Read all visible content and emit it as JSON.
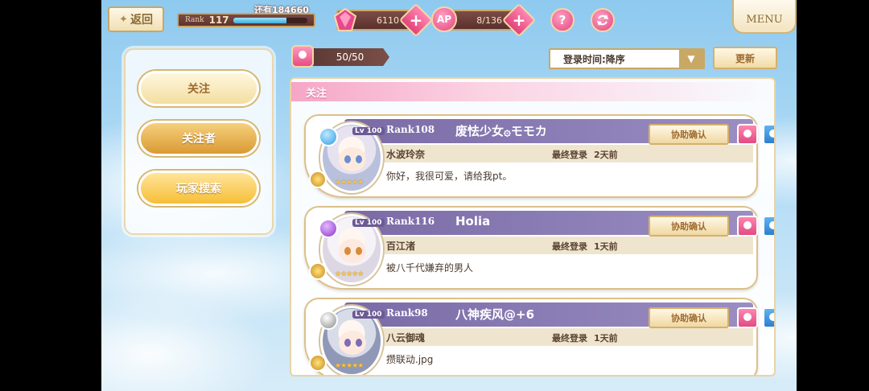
{
  "header": {
    "back_label": "返回",
    "rank_label": "Rank",
    "rank_value": "117",
    "rank_remaining": "还有184660",
    "xp_progress": 0.72,
    "gems": "6110",
    "ap_label": "AP",
    "ap": "8/136",
    "help_label": "?",
    "menu_label": "MENU"
  },
  "sidebar": {
    "items": [
      {
        "label": "关注"
      },
      {
        "label": "关注者"
      },
      {
        "label": "玩家搜索"
      }
    ]
  },
  "toolbar": {
    "count": "50/50",
    "sort_value": "登录时间:降序",
    "update_label": "更新"
  },
  "list": {
    "section_title": "关注",
    "support_label": "协助确认",
    "last_login_label": "最终登录",
    "lv_label": "Lv",
    "players": [
      {
        "rank": "Rank108",
        "name": "废怯少女۞モモカ",
        "chara": "水波玲奈",
        "last_login": "2天前",
        "comment": "你好，我很可爱，请给我pt。",
        "level": "100",
        "attr": "water"
      },
      {
        "rank": "Rank116",
        "name": "Holia",
        "chara": "百江渚",
        "last_login": "1天前",
        "comment": "被八千代嫌弃的男人",
        "level": "100",
        "attr": "dark"
      },
      {
        "rank": "Rank98",
        "name": "八神疾风@+6",
        "chara": "八云御魂",
        "last_login": "1天前",
        "comment": "攒联动.jpg",
        "level": "100",
        "attr": "wind"
      }
    ]
  }
}
